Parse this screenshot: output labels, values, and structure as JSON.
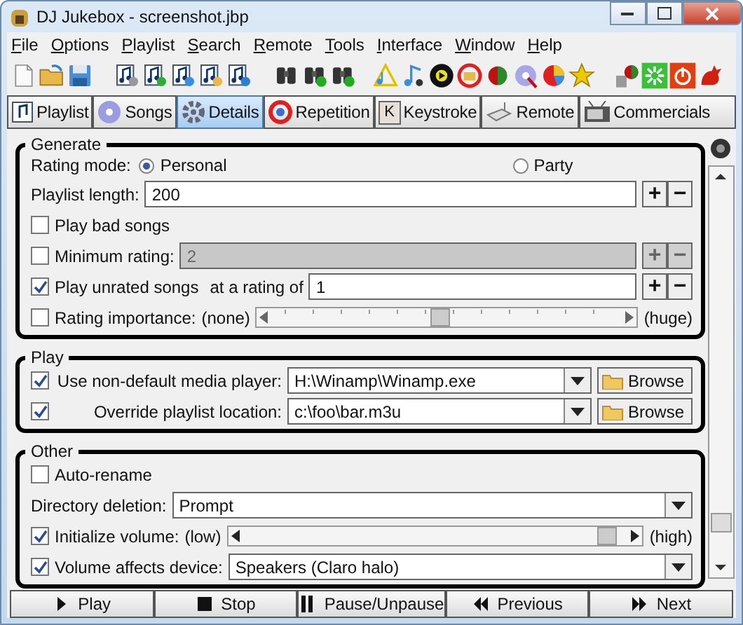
{
  "window": {
    "title": "DJ Jukebox - screenshot.jbp"
  },
  "menu": [
    "File",
    "Options",
    "Playlist",
    "Search",
    "Remote",
    "Tools",
    "Interface",
    "Window",
    "Help"
  ],
  "tabs": [
    {
      "label": "Playlist",
      "selected": false
    },
    {
      "label": "Songs",
      "selected": false
    },
    {
      "label": "Details",
      "selected": true
    },
    {
      "label": "Repetition",
      "selected": false
    },
    {
      "label": "Keystroke",
      "selected": false,
      "icon_text": "K"
    },
    {
      "label": "Remote",
      "selected": false
    },
    {
      "label": "Commercials",
      "selected": false
    }
  ],
  "generate": {
    "title": "Generate",
    "rating_mode": {
      "label": "Rating mode:",
      "options": [
        {
          "label": "Personal",
          "selected": true
        },
        {
          "label": "Party",
          "selected": false
        }
      ]
    },
    "playlist_length": {
      "label": "Playlist length:",
      "value": "200",
      "plus": "+",
      "minus": "−"
    },
    "play_bad_songs": {
      "label": "Play bad songs",
      "checked": false
    },
    "minimum_rating": {
      "label": "Minimum rating:",
      "checked": false,
      "disabled": true,
      "value": "2",
      "plus": "+",
      "minus": "−"
    },
    "play_unrated": {
      "label": "Play unrated songs",
      "checked": true,
      "suffix": "at a rating of",
      "value": "1",
      "plus": "+",
      "minus": "−"
    },
    "rating_importance": {
      "label": "Rating importance:",
      "checked": false,
      "min_label": "(none)",
      "max_label": "(huge)",
      "level": 0.48
    }
  },
  "play": {
    "title": "Play",
    "rows": [
      {
        "checked": true,
        "label": "Use non-default media player:",
        "value": "H:\\Winamp\\Winamp.exe",
        "button": "Browse"
      },
      {
        "checked": true,
        "label": "Override playlist location:",
        "value": "c:\\foo\\bar.m3u",
        "button": "Browse"
      }
    ]
  },
  "other": {
    "title": "Other",
    "auto_rename": {
      "label": "Auto-rename",
      "checked": false
    },
    "directory_deletion": {
      "label": "Directory deletion:",
      "value": "Prompt"
    },
    "initialize_volume": {
      "checked": true,
      "label": "Initialize volume:",
      "min_label": "(low)",
      "max_label": "(high)",
      "level": 0.97
    },
    "volume_device": {
      "checked": true,
      "label": "Volume affects device:",
      "value": "Speakers (Claro halo)"
    }
  },
  "transport": [
    {
      "kind": "play",
      "label": "Play"
    },
    {
      "kind": "stop",
      "label": "Stop"
    },
    {
      "kind": "pause",
      "label": "Pause/Unpause"
    },
    {
      "kind": "previous",
      "label": "Previous"
    },
    {
      "kind": "next",
      "label": "Next"
    }
  ]
}
